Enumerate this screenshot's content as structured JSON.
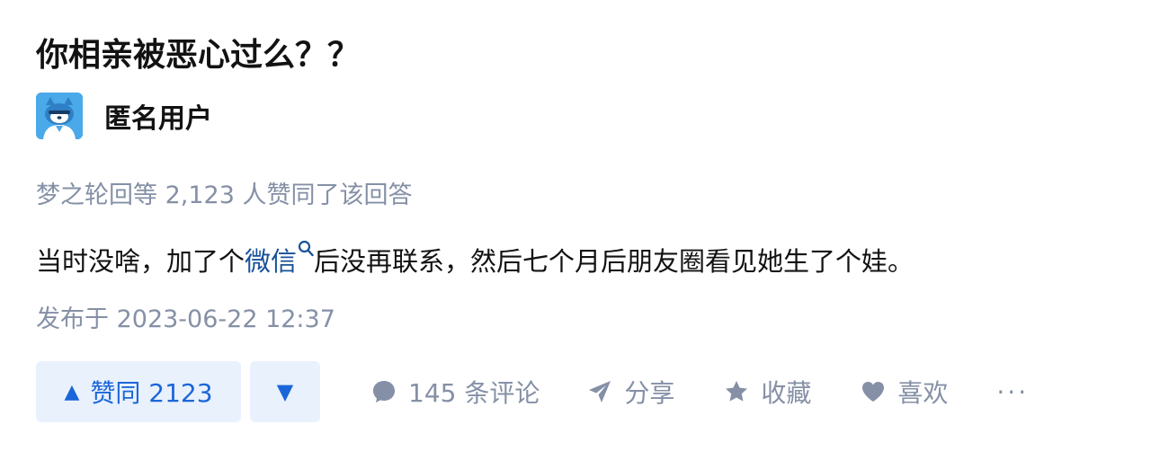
{
  "question": {
    "title": "你相亲被恶心过么？？"
  },
  "author": {
    "name": "匿名用户",
    "avatar_icon": "anonymous-avatar"
  },
  "voters_line": "梦之轮回等 2,123 人赞同了该回答",
  "content": {
    "before": "当时没啥，加了个",
    "link_text": "微信",
    "after": "后没再联系，然后七个月后朋友圈看见她生了个娃。"
  },
  "publish_time": "发布于 2023-06-22 12:37",
  "actions": {
    "upvote_label": "赞同 2123",
    "upvote_icon": "▲",
    "downvote_icon": "▼",
    "comments_label": "145 条评论",
    "share_label": "分享",
    "favorite_label": "收藏",
    "like_label": "喜欢",
    "more_label": "···"
  },
  "colors": {
    "text": "#121212",
    "meta": "#8590a6",
    "link": "#175199",
    "vote_bg": "#e9f1fd",
    "vote_fg": "#1a66d8"
  }
}
